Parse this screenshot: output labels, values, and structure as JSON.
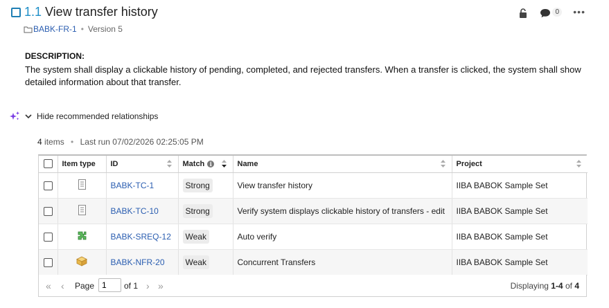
{
  "header": {
    "item_number": "1.1",
    "title": "View transfer history",
    "comment_count": "0",
    "more_label": "•••"
  },
  "meta": {
    "doc_id": "BABK-FR-1",
    "separator": "•",
    "version": "Version 5"
  },
  "description": {
    "label": "DESCRIPTION:",
    "text": "The system shall display a clickable history of pending, completed, and rejected transfers. When a transfer is clicked, the system shall show detailed information about that transfer."
  },
  "relationships": {
    "toggle_label": "Hide recommended relationships",
    "items_count": "4",
    "items_word": "items",
    "separator": "•",
    "last_run": "Last run 07/02/2026 02:25:05 PM"
  },
  "table": {
    "columns": {
      "item_type": "Item type",
      "id": "ID",
      "match": "Match",
      "name": "Name",
      "project": "Project"
    },
    "rows": [
      {
        "icon": "test-case-icon",
        "id": "BABK-TC-1",
        "match": "Strong",
        "name": "View transfer history",
        "project": "IIBA BABOK Sample Set"
      },
      {
        "icon": "test-case-icon",
        "id": "BABK-TC-10",
        "match": "Strong",
        "name": "Verify system displays clickable history of transfers - edit",
        "project": "IIBA BABOK Sample Set"
      },
      {
        "icon": "puzzle-icon",
        "id": "BABK-SREQ-12",
        "match": "Weak",
        "name": "Auto verify",
        "project": "IIBA BABOK Sample Set"
      },
      {
        "icon": "box-icon",
        "id": "BABK-NFR-20",
        "match": "Weak",
        "name": "Concurrent Transfers",
        "project": "IIBA BABOK Sample Set"
      }
    ]
  },
  "pager": {
    "first": "«",
    "prev": "‹",
    "page_label": "Page",
    "page_value": "1",
    "of_label": "of 1",
    "next": "›",
    "last": "»",
    "displaying_prefix": "Displaying",
    "displaying_range": "1-4",
    "displaying_of": "of",
    "displaying_total": "4"
  },
  "colors": {
    "accent_blue": "#1f8fc8",
    "link_blue": "#2a5db0",
    "sparkle_purple": "#7b3fe4",
    "puzzle_green": "#3c9a3c",
    "box_yellow": "#e8b84a"
  }
}
